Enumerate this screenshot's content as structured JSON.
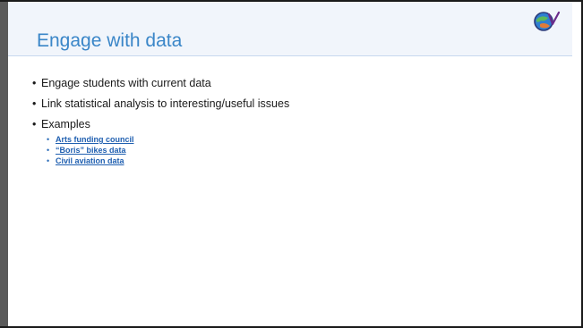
{
  "slide": {
    "title": "Engage with data",
    "logo_icon": "globe-ev-logo-icon",
    "accent_color": "#3a86c8",
    "link_color": "#1f5fb0",
    "bullets": [
      {
        "text": "Engage students with current data"
      },
      {
        "text": "Link statistical analysis to interesting/useful issues"
      },
      {
        "text": "Examples"
      }
    ],
    "examples": [
      {
        "label": "Arts funding council"
      },
      {
        "label": "“Boris” bikes data"
      },
      {
        "label": "Civil aviation data"
      }
    ],
    "bullet_glyph": "•"
  }
}
